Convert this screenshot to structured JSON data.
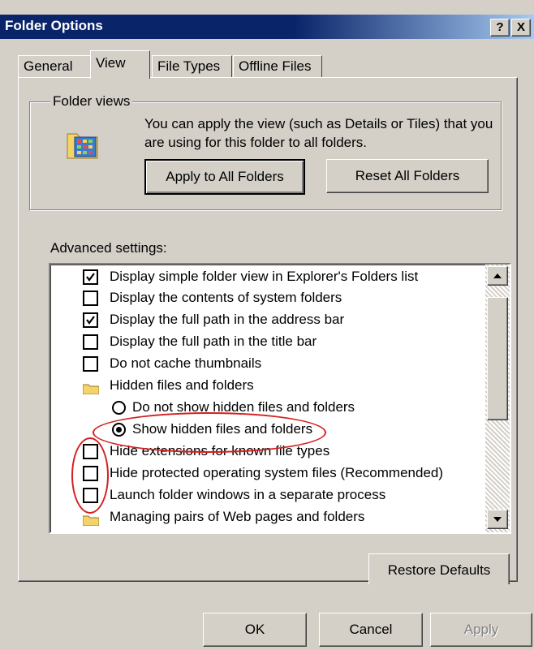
{
  "window": {
    "title": "Folder Options",
    "help_glyph": "?",
    "close_glyph": "X"
  },
  "tabs": [
    {
      "label": "General",
      "active": false
    },
    {
      "label": "View",
      "active": true
    },
    {
      "label": "File Types",
      "active": false
    },
    {
      "label": "Offline Files",
      "active": false
    }
  ],
  "folder_views": {
    "group_label": "Folder views",
    "description": "You can apply the view (such as Details or Tiles) that you are using for this folder to all folders.",
    "apply_button": "Apply to All Folders",
    "reset_button": "Reset All Folders"
  },
  "advanced": {
    "label": "Advanced settings:",
    "items": [
      {
        "type": "checkbox",
        "checked": true,
        "label": "Display simple folder view in Explorer's Folders list"
      },
      {
        "type": "checkbox",
        "checked": false,
        "label": "Display the contents of system folders"
      },
      {
        "type": "checkbox",
        "checked": true,
        "label": "Display the full path in the address bar"
      },
      {
        "type": "checkbox",
        "checked": false,
        "label": "Display the full path in the title bar"
      },
      {
        "type": "checkbox",
        "checked": false,
        "label": "Do not cache thumbnails"
      },
      {
        "type": "folder",
        "label": "Hidden files and folders"
      },
      {
        "type": "radio",
        "selected": false,
        "label": "Do not show hidden files and folders"
      },
      {
        "type": "radio",
        "selected": true,
        "label": "Show hidden files and folders"
      },
      {
        "type": "checkbox",
        "checked": false,
        "label": "Hide extensions for known file types"
      },
      {
        "type": "checkbox",
        "checked": false,
        "label": "Hide protected operating system files (Recommended)"
      },
      {
        "type": "checkbox",
        "checked": false,
        "label": "Launch folder windows in a separate process"
      },
      {
        "type": "folder",
        "label": "Managing pairs of Web pages and folders"
      }
    ],
    "restore_button": "Restore Defaults"
  },
  "footer": {
    "ok": "OK",
    "cancel": "Cancel",
    "apply": "Apply"
  },
  "colors": {
    "titlebar": "#0a246a",
    "annotation": "#d42020",
    "face": "#d4d0c8"
  }
}
